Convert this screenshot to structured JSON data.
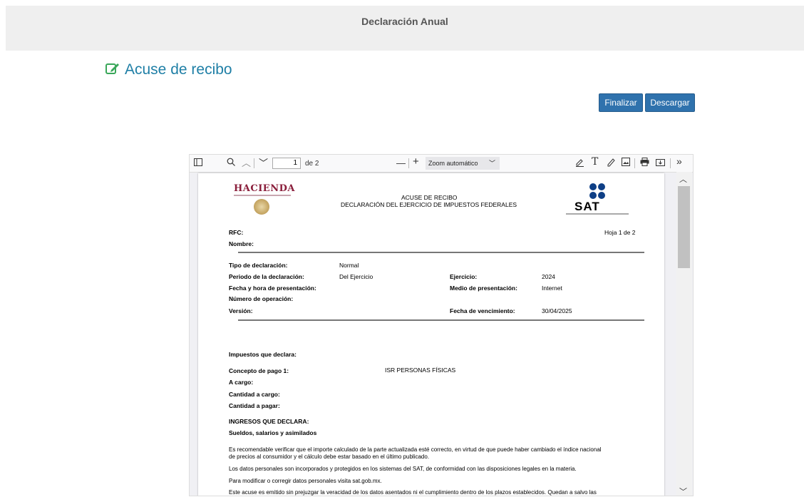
{
  "window": {
    "title": "Declaración Anual"
  },
  "header": {
    "title": "Acuse de recibo"
  },
  "buttons": {
    "finalizar": "Finalizar",
    "descargar": "Descargar"
  },
  "viewer": {
    "page_current": "1",
    "page_total": "de 2",
    "zoom": "Zoom automático"
  },
  "icons": [
    "edit-icon",
    "sidebar-toggle-icon",
    "search-icon",
    "chevron-up-icon",
    "chevron-down-icon",
    "zoom-out-icon",
    "zoom-in-icon",
    "highlight-icon",
    "text-icon",
    "draw-icon",
    "image-icon",
    "print-icon",
    "save-icon",
    "more-tools-icon"
  ],
  "colors": {
    "heading": "#1f7fa6",
    "button": "#2f72ad",
    "hacienda": "#8a1e3b",
    "sat": "#0e3f86"
  },
  "document": {
    "logo_left": "HACIENDA",
    "logo_right": "SAT",
    "title_line1": "ACUSE DE RECIBO",
    "title_line2": "DECLARACIÓN DEL EJERCICIO DE IMPUESTOS FEDERALES",
    "rfc_label": "RFC:",
    "nombre_label": "Nombre:",
    "hoja": "Hoja 1 de 2",
    "tipo_label": "Tipo de declaración:",
    "tipo_value": "Normal",
    "periodo_label": "Periodo de la declaración:",
    "periodo_value": "Del Ejercicio",
    "ejercicio_label": "Ejercicio:",
    "ejercicio_value": "2024",
    "fecha_label": "Fecha y hora de presentación:",
    "medio_label": "Medio de presentación:",
    "medio_value": "Internet",
    "numero_label": "Número de operación:",
    "version_label": "Versión:",
    "vencimiento_label": "Fecha de vencimiento:",
    "vencimiento_value": "30/04/2025",
    "impuestos_label": "Impuestos que declara:",
    "concepto_label": "Concepto de pago 1:",
    "concepto_value": "ISR PERSONAS FÍSICAS",
    "acargo_label": "A cargo:",
    "cantidad_cargo_label": "Cantidad a cargo:",
    "cantidad_pagar_label": "Cantidad a pagar:",
    "ingresos_label": "INGRESOS QUE DECLARA:",
    "sueldos_label": "Sueldos, salarios y asimilados",
    "para1_line1": "Es recomendable verificar que el importe calculado de la parte actualizada esté correcto, en virtud de que puede haber cambiado el índice nacional",
    "para1_line2": "de precios al consumidor y el cálculo debe estar basado en el último publicado.",
    "para2": "Los datos personales son incorporados y protegidos en los sistemas del SAT, de conformidad con las disposiciones legales en la materia.",
    "para3": "Para modificar o corregir datos personales visita sat.gob.mx.",
    "para4": "Este acuse es emitido sin prejuzgar la veracidad de los datos asentados ni el cumplimiento dentro de los plazos establecidos. Quedan a salvo las"
  }
}
